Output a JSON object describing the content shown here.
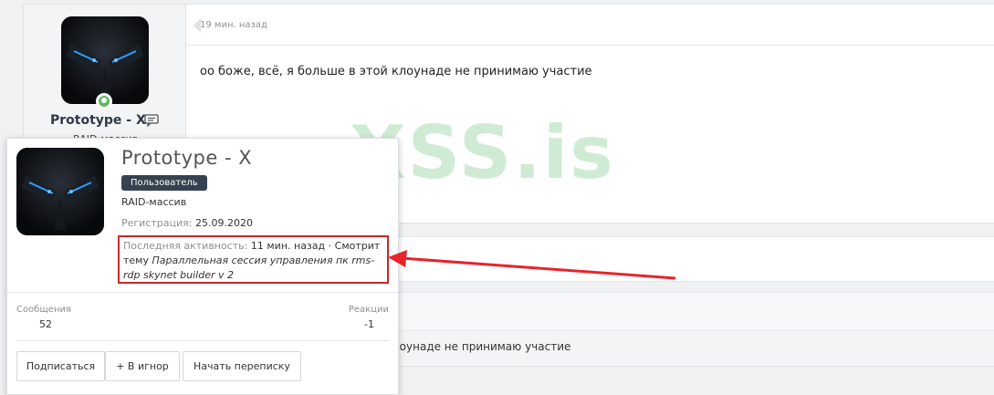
{
  "post": {
    "time": "19 мин. назад",
    "text": "оо боже, всё, я больше в этой клоунаде не принимаю участие",
    "username": "Prototype - X",
    "usertitle": "RAID-массив"
  },
  "watermark": "XSS.is",
  "quote_fragment": "лоунаде не принимаю участие",
  "card": {
    "name": "Prototype - X",
    "role": "Пользователь",
    "title": "RAID-массив",
    "registration_label": "Регистрация:",
    "registration_date": "25.09.2020",
    "activity_label": "Последняя активность:",
    "activity_time": "11 мин. назад",
    "activity_action": "· Смотрит тему",
    "activity_topic": "Параллельная сессия управления пк rms-rdp skynet builder v 2",
    "messages_label": "Сообщения",
    "messages_value": "52",
    "reactions_label": "Реакции",
    "reactions_value": "-1",
    "buttons": {
      "follow": "Подписаться",
      "ignore": "+ В игнор",
      "message": "Начать переписку"
    }
  },
  "colors": {
    "annotation": "#e8232a",
    "online": "#5fb85f",
    "badge": "#36424f"
  },
  "icons": [
    "online-status-icon",
    "message-icon"
  ]
}
